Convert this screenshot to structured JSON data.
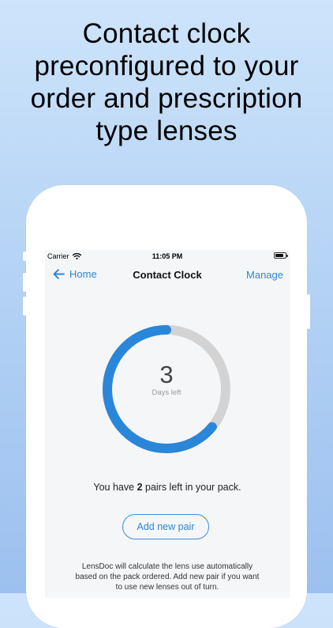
{
  "headline": {
    "lines": [
      "Contact clock",
      "preconfigured to your",
      "order and prescription",
      "type lenses"
    ]
  },
  "status_bar": {
    "carrier": "Carrier",
    "time": "11:05 PM",
    "battery_level": 0.85
  },
  "nav": {
    "back_label": "Home",
    "title": "Contact Clock",
    "action_label": "Manage"
  },
  "clock": {
    "days_left": "3",
    "caption": "Days left",
    "progress_fraction": 0.64,
    "progress_color": "#2a86d8",
    "track_color": "#d3d3d3"
  },
  "pack": {
    "prefix": "You have ",
    "count": "2",
    "suffix": " pairs left in your pack."
  },
  "add_button_label": "Add new pair",
  "info": {
    "lines": [
      "LensDoc will calculate the lens use automatically",
      "based on the pack ordered. Add new pair if you want",
      "to use new lenses out of turn."
    ]
  },
  "colors": {
    "accent": "#2a86d8",
    "background_top": "#cde4fb",
    "background_bottom": "#9cc0ef"
  }
}
